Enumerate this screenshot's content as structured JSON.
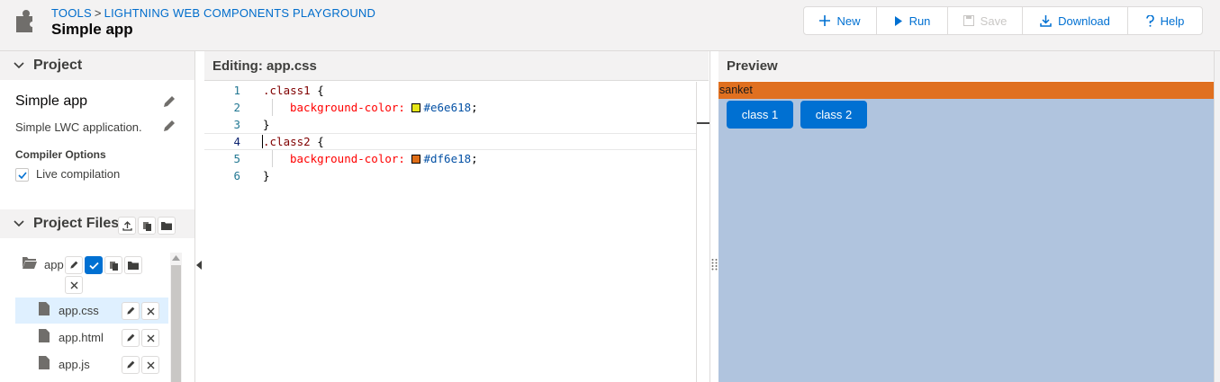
{
  "header": {
    "breadcrumb": [
      "TOOLS",
      "LIGHTNING WEB COMPONENTS PLAYGROUND"
    ],
    "breadcrumb_sep": ">",
    "title": "Simple app",
    "buttons": {
      "new": "New",
      "run": "Run",
      "save": "Save",
      "download": "Download",
      "help": "Help"
    }
  },
  "sidebar": {
    "project_header": "Project",
    "project_name": "Simple app",
    "project_description": "Simple LWC application.",
    "compiler_options_label": "Compiler Options",
    "live_compilation_label": "Live compilation",
    "live_compilation_checked": true,
    "files_header": "Project Files",
    "folder_name": "app",
    "files": [
      {
        "name": "app.css",
        "selected": true
      },
      {
        "name": "app.html",
        "selected": false
      },
      {
        "name": "app.js",
        "selected": false
      }
    ]
  },
  "editor": {
    "title": "Editing: app.css",
    "lines": [
      {
        "num": "1",
        "selector": ".class1",
        "open": " {"
      },
      {
        "num": "2",
        "property": "background-color:",
        "color": "#e6e618",
        "value": "#e6e618",
        "end": ";"
      },
      {
        "num": "3",
        "close": "}"
      },
      {
        "num": "4",
        "selector": ".class2",
        "open": " {"
      },
      {
        "num": "5",
        "property": "background-color:",
        "color": "#df6e18",
        "value": "#df6e18",
        "end": ";"
      },
      {
        "num": "6",
        "close": "}"
      }
    ]
  },
  "preview": {
    "title": "Preview",
    "bar_text": "sanket",
    "bar_color": "#e07020",
    "background_color": "#b0c4de",
    "buttons": [
      "class 1",
      "class 2"
    ],
    "button_color": "#0070d2"
  },
  "colors": {
    "accent": "#0070d2",
    "header_bg": "#f3f2f2",
    "selected_row": "#dff0ff"
  }
}
